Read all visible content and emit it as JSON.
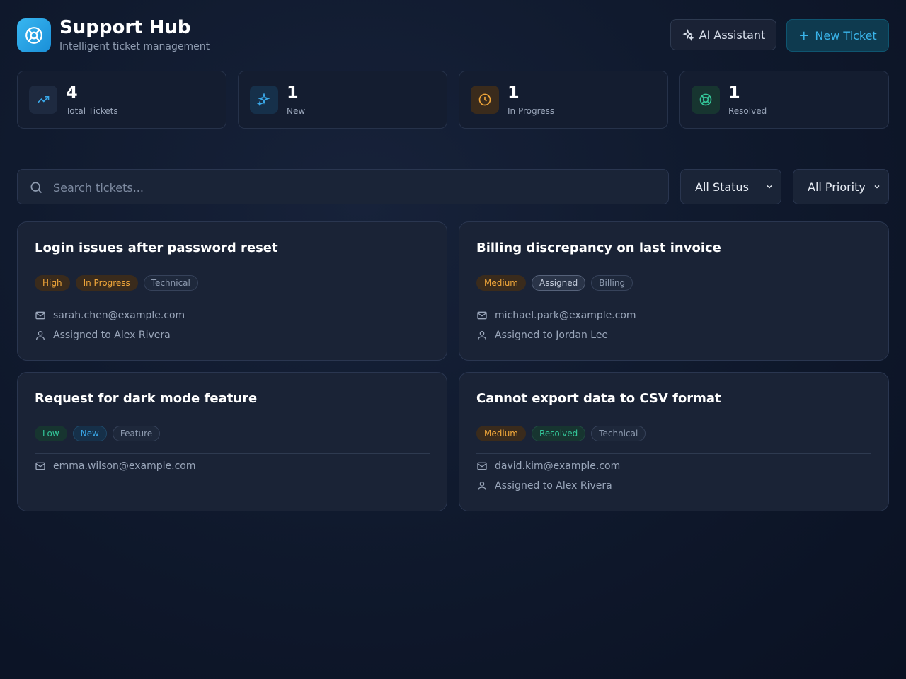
{
  "app": {
    "title": "Support Hub",
    "subtitle": "Intelligent ticket management"
  },
  "actions": {
    "ai_label": "AI Assistant",
    "new_label": "New Ticket"
  },
  "stats": [
    {
      "value": "4",
      "label": "Total Tickets",
      "icon": "trending-up-icon",
      "color": "#3aa8e8"
    },
    {
      "value": "1",
      "label": "New",
      "icon": "sparkles-icon",
      "color": "#3aa8e8"
    },
    {
      "value": "1",
      "label": "In Progress",
      "icon": "clock-icon",
      "color": "#f0a63a"
    },
    {
      "value": "1",
      "label": "Resolved",
      "icon": "life-buoy-icon",
      "color": "#34c79a"
    }
  ],
  "search": {
    "placeholder": "Search tickets..."
  },
  "filters": {
    "status": "All Status",
    "priority": "All Priority"
  },
  "tickets": [
    {
      "title": "Login issues after password reset",
      "priority": "High",
      "status": "In Progress",
      "category": "Technical",
      "email": "sarah.chen@example.com",
      "assigned": "Assigned to Alex Rivera"
    },
    {
      "title": "Billing discrepancy on last invoice",
      "priority": "Medium",
      "status": "Assigned",
      "category": "Billing",
      "email": "michael.park@example.com",
      "assigned": "Assigned to Jordan Lee"
    },
    {
      "title": "Request for dark mode feature",
      "priority": "Low",
      "status": "New",
      "category": "Feature",
      "email": "emma.wilson@example.com",
      "assigned": ""
    },
    {
      "title": "Cannot export data to CSV format",
      "priority": "Medium",
      "status": "Resolved",
      "category": "Technical",
      "email": "david.kim@example.com",
      "assigned": "Assigned to Alex Rivera"
    }
  ],
  "colors": {
    "accent": "#3aa8e8",
    "warning": "#f0a63a",
    "success": "#34c79a"
  }
}
